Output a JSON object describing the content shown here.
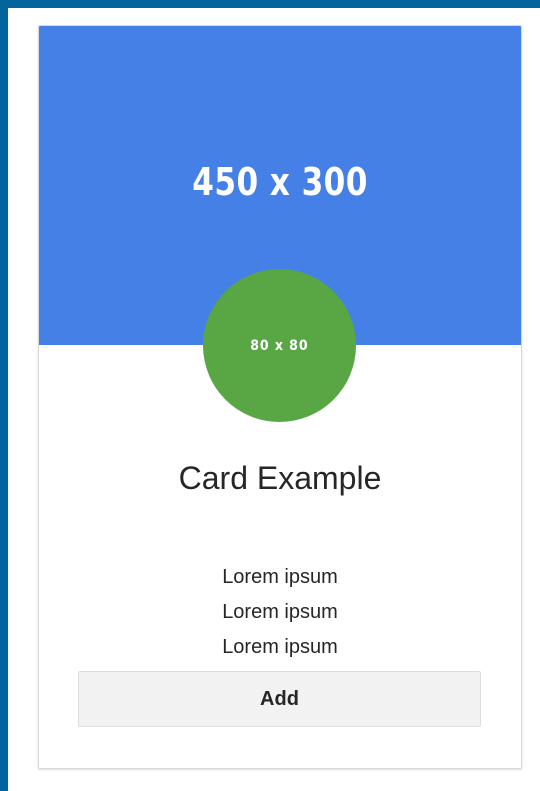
{
  "card": {
    "image_label": "450 x 300",
    "avatar_label": "80 x 80",
    "title": "Card Example",
    "lines": [
      "Lorem ipsum",
      "Lorem ipsum",
      "Lorem ipsum"
    ],
    "button_label": "Add"
  },
  "colors": {
    "page_border": "#04649c",
    "banner": "#4580e6",
    "avatar": "#58a644",
    "button_bg": "#f2f2f2",
    "text": "#262626"
  }
}
